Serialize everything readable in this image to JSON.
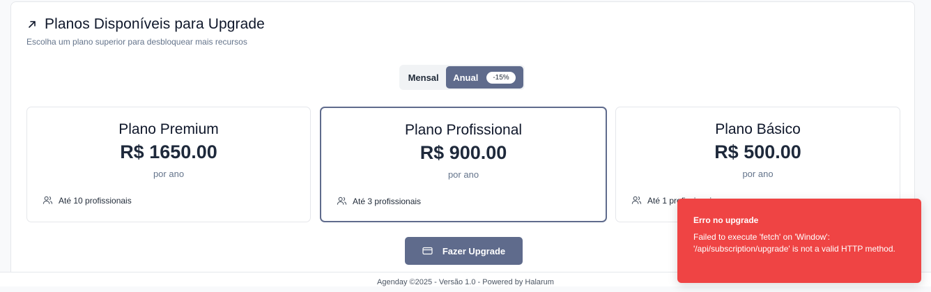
{
  "header": {
    "title": "Planos Disponíveis para Upgrade",
    "subtitle": "Escolha um plano superior para desbloquear mais recursos",
    "icon": "arrow-up-right-icon"
  },
  "billing_toggle": {
    "options": [
      "Mensal",
      "Anual"
    ],
    "selected": "Anual",
    "discount_badge": "-15%"
  },
  "plans": [
    {
      "name": "Plano Premium",
      "price": "R$ 1650.00",
      "period": "por ano",
      "feature": "Até 10 profissionais",
      "selected": false
    },
    {
      "name": "Plano Profissional",
      "price": "R$ 900.00",
      "period": "por ano",
      "feature": "Até 3 profissionais",
      "selected": true
    },
    {
      "name": "Plano Básico",
      "price": "R$ 500.00",
      "period": "por ano",
      "feature": "Até 1 profissionais",
      "selected": false
    }
  ],
  "upgrade_button": {
    "label": "Fazer Upgrade",
    "icon": "credit-card-icon"
  },
  "footer": {
    "text": "Agenday ©2025 - Versão 1.0 - Powered by Halarum"
  },
  "toast": {
    "title": "Erro no upgrade",
    "message": "Failed to execute 'fetch' on 'Window': '/api/subscription/upgrade' is not a valid HTTP method."
  },
  "colors": {
    "accent": "#5f6b8c",
    "error": "#ef4444",
    "text": "#0f172a",
    "muted": "#64748b"
  }
}
